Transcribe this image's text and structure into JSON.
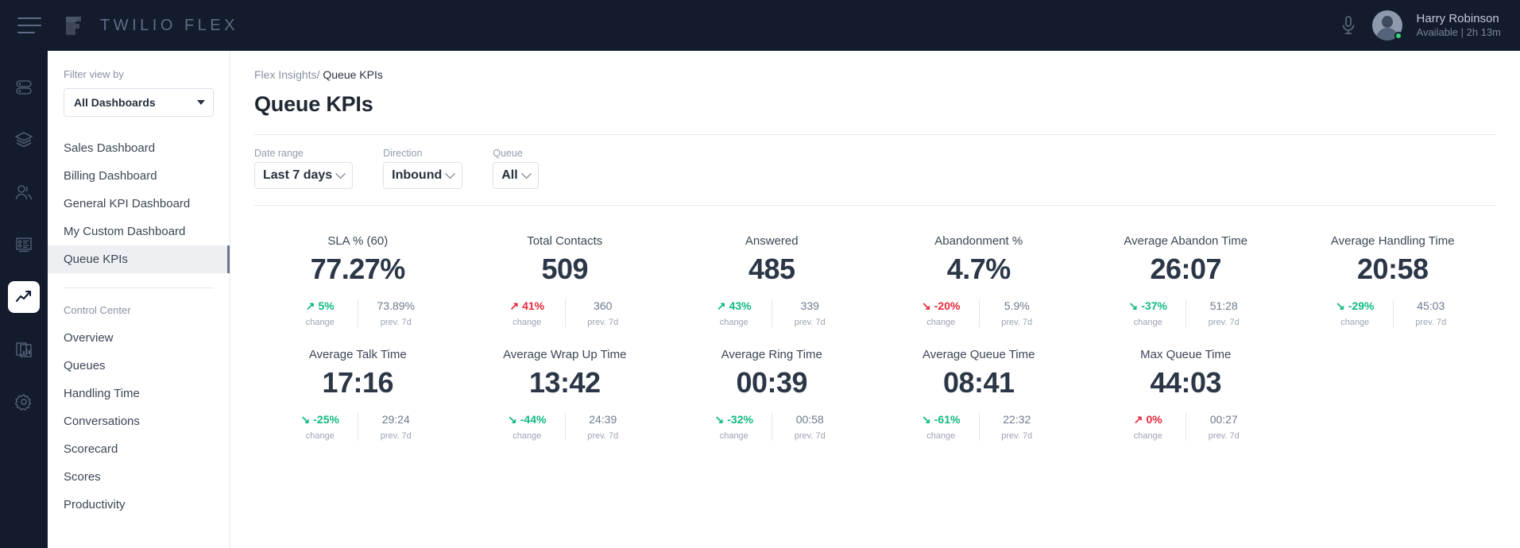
{
  "topbar": {
    "brand": "TWILIO FLEX",
    "menu_icon": "hamburger-icon",
    "mic_icon": "microphone-icon",
    "user_name": "Harry Robinson",
    "user_status": "Available | 2h 13m"
  },
  "rail": {
    "items": [
      {
        "icon": "toggle-list-icon",
        "active": false
      },
      {
        "icon": "layers-icon",
        "active": false
      },
      {
        "icon": "people-icon",
        "active": false
      },
      {
        "icon": "form-list-icon",
        "active": false
      },
      {
        "icon": "trending-up-icon",
        "active": true
      },
      {
        "icon": "reports-icon",
        "active": false
      },
      {
        "icon": "gear-icon",
        "active": false
      }
    ]
  },
  "sidebar": {
    "filter_label": "Filter view by",
    "dropdown_value": "All Dashboards",
    "dashboards": [
      {
        "label": "Sales Dashboard",
        "active": false
      },
      {
        "label": "Billing Dashboard",
        "active": false
      },
      {
        "label": "General KPI Dashboard",
        "active": false
      },
      {
        "label": "My Custom Dashboard",
        "active": false
      },
      {
        "label": "Queue KPIs",
        "active": true
      }
    ],
    "section_label": "Control Center",
    "control_center": [
      {
        "label": "Overview"
      },
      {
        "label": "Queues"
      },
      {
        "label": "Handling Time"
      },
      {
        "label": "Conversations"
      },
      {
        "label": "Scorecard"
      },
      {
        "label": "Scores"
      },
      {
        "label": "Productivity"
      }
    ]
  },
  "main": {
    "breadcrumb_root": "Flex Insights/",
    "breadcrumb_current": "Queue KPIs",
    "page_title": "Queue KPIs",
    "filters": [
      {
        "label": "Date range",
        "value": "Last 7 days"
      },
      {
        "label": "Direction",
        "value": "Inbound"
      },
      {
        "label": "Queue",
        "value": "All"
      }
    ],
    "change_caption": "change",
    "prev_caption": "prev. 7d"
  },
  "colors": {
    "good": "#10B97F",
    "bad": "#E8283B",
    "nav_dark": "#121C2D",
    "value": "#2B3646"
  },
  "chart_data": {
    "type": "table",
    "title": "Queue KPIs",
    "columns": [
      "metric",
      "value",
      "change",
      "change_direction",
      "change_sentiment",
      "previous"
    ],
    "rows": [
      {
        "metric": "SLA % (60)",
        "value": "77.27%",
        "change": "5%",
        "dir": "up",
        "sentiment": "good",
        "previous": "73.89%"
      },
      {
        "metric": "Total Contacts",
        "value": "509",
        "change": "41%",
        "dir": "up",
        "sentiment": "bad",
        "previous": "360"
      },
      {
        "metric": "Answered",
        "value": "485",
        "change": "43%",
        "dir": "up",
        "sentiment": "good",
        "previous": "339"
      },
      {
        "metric": "Abandonment %",
        "value": "4.7%",
        "change": "-20%",
        "dir": "down",
        "sentiment": "bad",
        "previous": "5.9%"
      },
      {
        "metric": "Average Abandon Time",
        "value": "26:07",
        "change": "-37%",
        "dir": "down",
        "sentiment": "good",
        "previous": "51:28"
      },
      {
        "metric": "Average Handling Time",
        "value": "20:58",
        "change": "-29%",
        "dir": "down",
        "sentiment": "good",
        "previous": "45:03"
      },
      {
        "metric": "Average Talk Time",
        "value": "17:16",
        "change": "-25%",
        "dir": "down",
        "sentiment": "good",
        "previous": "29:24"
      },
      {
        "metric": "Average Wrap Up Time",
        "value": "13:42",
        "change": "-44%",
        "dir": "down",
        "sentiment": "good",
        "previous": "24:39"
      },
      {
        "metric": "Average Ring Time",
        "value": "00:39",
        "change": "-32%",
        "dir": "down",
        "sentiment": "good",
        "previous": "00:58"
      },
      {
        "metric": "Average Queue Time",
        "value": "08:41",
        "change": "-61%",
        "dir": "down",
        "sentiment": "good",
        "previous": "22:32"
      },
      {
        "metric": "Max Queue Time",
        "value": "44:03",
        "change": "0%",
        "dir": "up",
        "sentiment": "bad",
        "previous": "00:27"
      }
    ]
  }
}
